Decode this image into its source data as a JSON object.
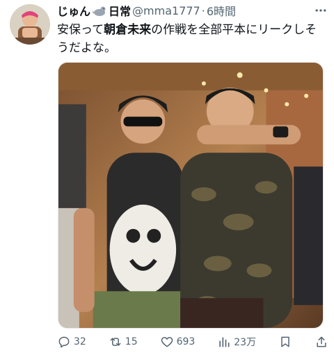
{
  "author": {
    "name": "じゅん",
    "badge": "日常",
    "handle": "@mma1777",
    "separator": "·",
    "time": "6時間"
  },
  "tweet": {
    "text_before": "安保って",
    "text_bold": "朝倉未来",
    "text_after": "の作戦を全部平本にリークしそうだよな。"
  },
  "actions": {
    "replies": "32",
    "retweets": "15",
    "likes": "693",
    "views": "23万"
  },
  "colors": {
    "secondary_text": "#536471",
    "primary_text": "#0f1419"
  }
}
